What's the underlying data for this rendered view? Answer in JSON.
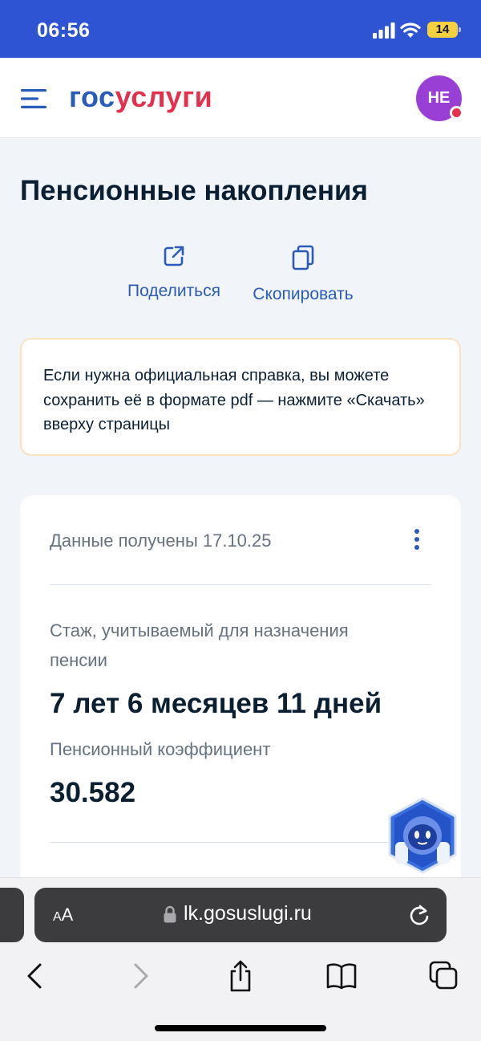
{
  "status_bar": {
    "time": "06:56",
    "battery": "14"
  },
  "header": {
    "logo_part1": "гос",
    "logo_part2": "услуги",
    "avatar_initials": "НЕ"
  },
  "page": {
    "title": "Пенсионные накопления"
  },
  "actions": {
    "share_label": "Поделиться",
    "copy_label": "Скопировать"
  },
  "notice": {
    "text": "Если нужна официальная справка, вы можете сохранить её в формате pdf — нажмите «Скачать» вверху страницы"
  },
  "card": {
    "received": "Данные получены 17.10.25",
    "seniority_label": "Стаж, учитываемый для назначения пенсии",
    "seniority_value": "7 лет 6 месяцев 11 дней",
    "coefficient_label": "Пенсионный коэффициент",
    "coefficient_value": "30.582"
  },
  "browser": {
    "text_size_small": "A",
    "text_size_large": "A",
    "url": "lk.gosuslugi.ru"
  },
  "colors": {
    "brand_blue": "#2e54d4",
    "link_blue": "#2a5bb8",
    "logo_red": "#e3304d",
    "avatar_purple": "#9a3fd6",
    "notice_border": "#f8e3bd"
  }
}
